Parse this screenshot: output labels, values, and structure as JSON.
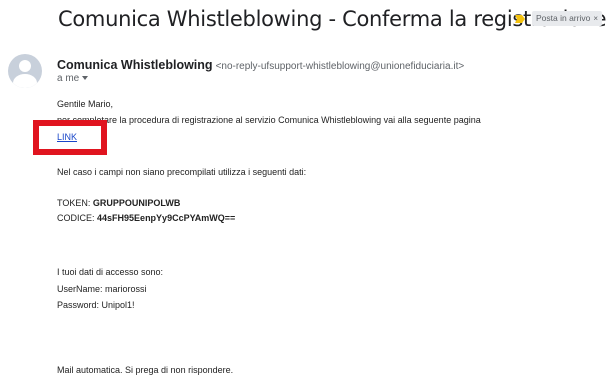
{
  "email": {
    "subject": "Comunica Whistleblowing - Conferma la registrazione",
    "label": "Posta in arrivo",
    "label_close": "×",
    "sender_name": "Comunica Whistleblowing",
    "sender_email": "<no-reply-ufsupport-whistleblowing@unionefiduciaria.it>",
    "recipient": "a me",
    "greeting": "Gentile Mario,",
    "intro": "per completare la procedura di registrazione al servizio Comunica Whistleblowing vai alla seguente pagina",
    "link_text": "LINK",
    "precompiled_note": "Nel caso i campi non siano precompilati utilizza i seguenti dati:",
    "token_label": "TOKEN:",
    "token_value": "GRUPPOUNIPOLWB",
    "code_label": "CODICE:",
    "code_value": "44sFH95EenpYy9CcPYAmWQ==",
    "access_intro": "I tuoi dati di accesso sono:",
    "username_line": "UserName: mariorossi",
    "password_line": "Password: Unipol1!",
    "footer": "Mail automatica. Si prega di non rispondere."
  },
  "colors": {
    "link": "#1a47c9",
    "highlight_box": "#e0141f",
    "importance_marker": "#f4c20d"
  },
  "icons": {
    "importance": "importance-marker-icon",
    "avatar": "default-avatar-icon",
    "recipient_details": "chevron-down-icon"
  }
}
